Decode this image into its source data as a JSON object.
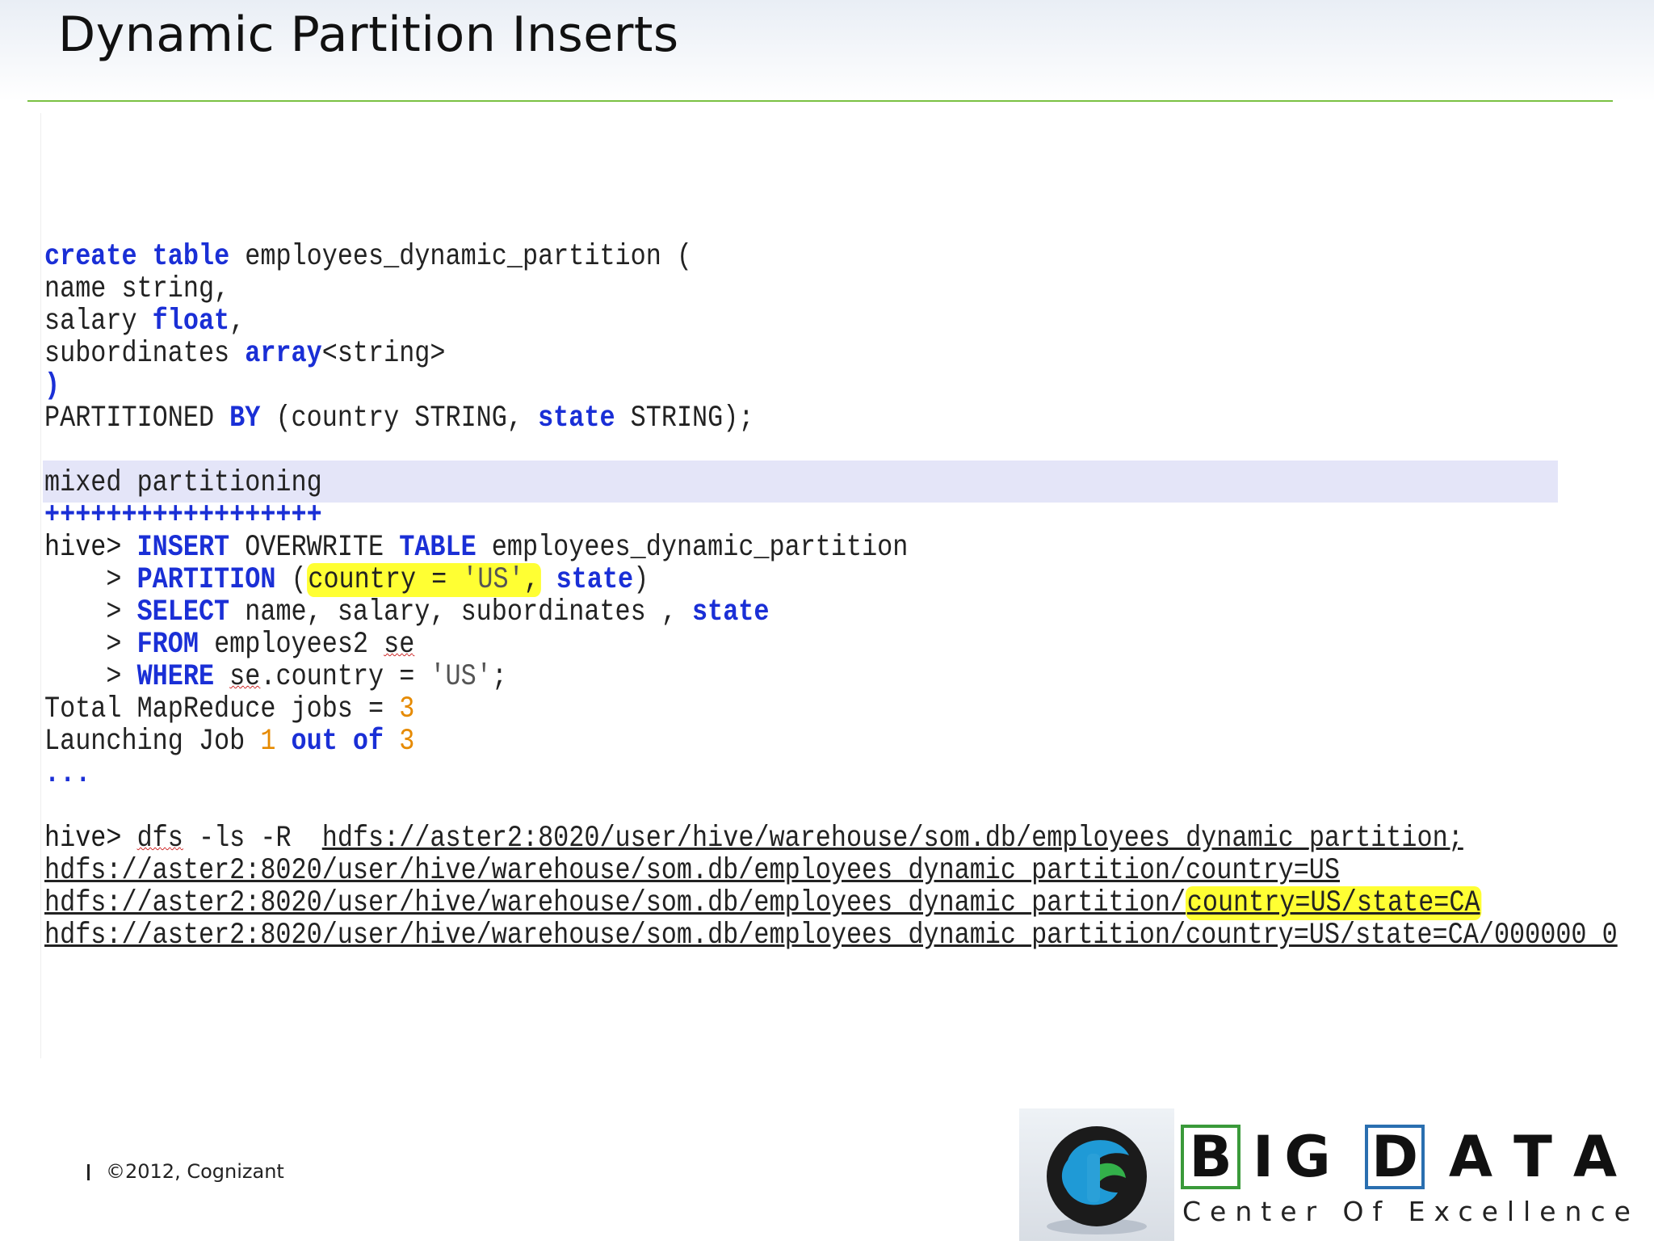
{
  "slide": {
    "title": "Dynamic Partition Inserts",
    "footer": "©2012, Cognizant"
  },
  "code": {
    "create_kw": "create",
    "table_kw": "table",
    "create_rest": " employees_dynamic_partition (",
    "line_name": "name string,",
    "salary_a": "salary ",
    "salary_kw": "float",
    "salary_b": ",",
    "subs_a": "subordinates ",
    "subs_kw": "array",
    "subs_b": "<string>",
    "close_paren": ")",
    "part_a": "PARTITIONED ",
    "part_kw": "BY",
    "part_b": " (country STRING, ",
    "part_kw2": "state",
    "part_c": " STRING);",
    "mixed": "mixed partitioning",
    "plus": "++++++++++++++++++",
    "prompt": "hive> ",
    "ins_kw": "INSERT",
    "ins_b": " OVERWRITE ",
    "ins_kw2": "TABLE",
    "ins_c": " employees_dynamic_partition",
    "cont": "    > ",
    "partition_kw": "PARTITION",
    "partition_b": " (",
    "partition_hl_a": "country = ",
    "partition_hl_str": "'US'",
    "partition_hl_c": ",",
    "partition_c": " ",
    "partition_kw2": "state",
    "partition_d": ")",
    "select_kw": "SELECT",
    "select_b": " name, salary, subordinates , ",
    "select_kw2": "state",
    "from_kw": "FROM",
    "from_b": " employees2 ",
    "from_se": "se",
    "where_kw": "WHERE",
    "where_b": " ",
    "where_se": "se",
    "where_c": ".country = ",
    "where_str": "'US'",
    "where_d": ";",
    "total_a": "Total MapReduce jobs = ",
    "total_num": "3",
    "launch_a": "Launching Job ",
    "launch_num1": "1",
    "launch_kw": "out of",
    "launch_num2": "3",
    "ellipsis": "...",
    "dfs_prompt": "hive> ",
    "dfs_cmd": "dfs",
    "dfs_flags": " -ls -R  ",
    "dfs_path": "hdfs://aster2:8020/user/hive/warehouse/som.db/employees_dynamic_partition;",
    "out1": "hdfs://aster2:8020/user/hive/warehouse/som.db/employees_dynamic_partition/country=US",
    "out2_a": "hdfs://aster2:8020/user/hive/warehouse/som.db/employees_dynamic_partition/",
    "out2_hl": "country=US/state=CA",
    "out3": "hdfs://aster2:8020/user/hive/warehouse/som.db/employees_dynamic_partition/country=US/state=CA/000000_0"
  },
  "logo": {
    "letters": [
      "B",
      "I",
      "G",
      "D",
      "A",
      "T",
      "A"
    ],
    "tagline": "Center Of Excellence",
    "colors": {
      "green": "#3a9a3a",
      "blue": "#2a6fb0"
    }
  },
  "colors": {
    "keyword": "#1a2fd6",
    "number": "#e68a00",
    "highlight": "#ffff33",
    "rule": "#7ac143"
  }
}
